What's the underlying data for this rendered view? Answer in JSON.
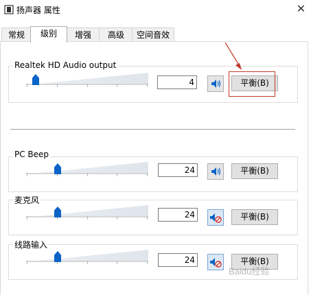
{
  "window": {
    "title": "扬声器 属性",
    "close_glyph": "✕"
  },
  "tabs": [
    {
      "label": "常规",
      "active": false
    },
    {
      "label": "级别",
      "active": true
    },
    {
      "label": "增强",
      "active": false
    },
    {
      "label": "高级",
      "active": false
    },
    {
      "label": "空间音效",
      "active": false
    }
  ],
  "devices": [
    {
      "name": "Realtek HD Audio output",
      "level": "4",
      "slider_fraction": 0.04,
      "muted": false,
      "balance_label": "平衡(B)"
    },
    {
      "name": "PC Beep",
      "level": "24",
      "slider_fraction": 0.24,
      "muted": false,
      "balance_label": "平衡(B)"
    },
    {
      "name": "麦克风",
      "level": "24",
      "slider_fraction": 0.24,
      "muted": true,
      "balance_label": "平衡(B)"
    },
    {
      "name": "线路输入",
      "level": "24",
      "slider_fraction": 0.24,
      "muted": true,
      "balance_label": "平衡(B)"
    }
  ],
  "icons": {
    "speaker": "speaker-icon",
    "muted": "muted-speaker-icon",
    "window": "speaker-properties-icon"
  },
  "colors": {
    "thumb": "#0a64c8",
    "annotation": "#c0392b"
  },
  "watermark": "Baidu经验"
}
